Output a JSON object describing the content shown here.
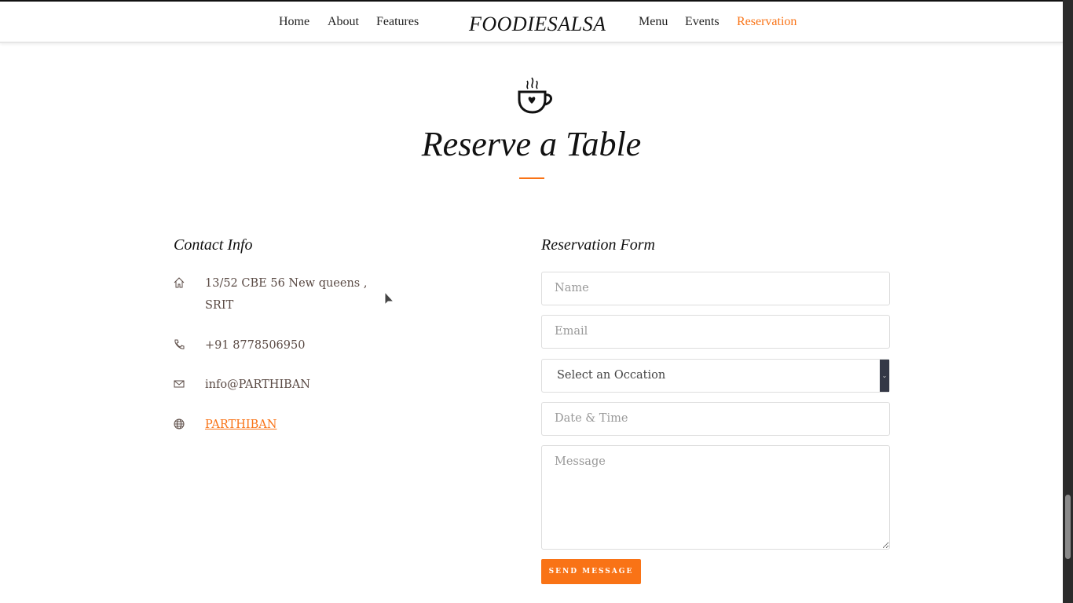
{
  "nav": {
    "left": [
      "Home",
      "About",
      "Features"
    ],
    "brand": "FOODIESALSA",
    "right": [
      "Menu",
      "Events",
      "Reservation"
    ],
    "active": "Reservation"
  },
  "section": {
    "icon": "coffee-cup-heart-icon",
    "title": "Reserve a Table"
  },
  "contact": {
    "heading": "Contact Info",
    "items": [
      {
        "icon": "home-icon",
        "text": "13/52 CBE 56 New queens , SRIT"
      },
      {
        "icon": "phone-icon",
        "text": "+91 8778506950"
      },
      {
        "icon": "mail-icon",
        "text": "info@PARTHIBAN"
      },
      {
        "icon": "globe-icon",
        "text": "PARTHIBAN"
      }
    ]
  },
  "form": {
    "heading": "Reservation Form",
    "name_placeholder": "Name",
    "email_placeholder": "Email",
    "occasion_selected": "Select an Occation",
    "datetime_placeholder": "Date & Time",
    "message_placeholder": "Message",
    "submit": "SEND MESSAGE"
  },
  "colors": {
    "accent": "#f97316"
  }
}
